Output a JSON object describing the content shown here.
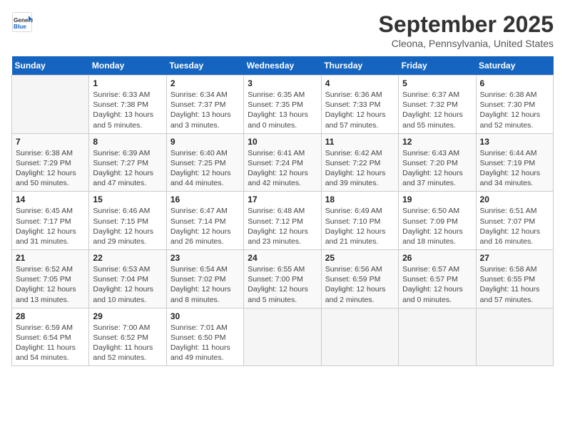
{
  "header": {
    "logo_line1": "General",
    "logo_line2": "Blue",
    "month": "September 2025",
    "location": "Cleona, Pennsylvania, United States"
  },
  "days_of_week": [
    "Sunday",
    "Monday",
    "Tuesday",
    "Wednesday",
    "Thursday",
    "Friday",
    "Saturday"
  ],
  "weeks": [
    [
      {
        "day": "",
        "text": ""
      },
      {
        "day": "1",
        "text": "Sunrise: 6:33 AM\nSunset: 7:38 PM\nDaylight: 13 hours\nand 5 minutes."
      },
      {
        "day": "2",
        "text": "Sunrise: 6:34 AM\nSunset: 7:37 PM\nDaylight: 13 hours\nand 3 minutes."
      },
      {
        "day": "3",
        "text": "Sunrise: 6:35 AM\nSunset: 7:35 PM\nDaylight: 13 hours\nand 0 minutes."
      },
      {
        "day": "4",
        "text": "Sunrise: 6:36 AM\nSunset: 7:33 PM\nDaylight: 12 hours\nand 57 minutes."
      },
      {
        "day": "5",
        "text": "Sunrise: 6:37 AM\nSunset: 7:32 PM\nDaylight: 12 hours\nand 55 minutes."
      },
      {
        "day": "6",
        "text": "Sunrise: 6:38 AM\nSunset: 7:30 PM\nDaylight: 12 hours\nand 52 minutes."
      }
    ],
    [
      {
        "day": "7",
        "text": "Sunrise: 6:38 AM\nSunset: 7:29 PM\nDaylight: 12 hours\nand 50 minutes."
      },
      {
        "day": "8",
        "text": "Sunrise: 6:39 AM\nSunset: 7:27 PM\nDaylight: 12 hours\nand 47 minutes."
      },
      {
        "day": "9",
        "text": "Sunrise: 6:40 AM\nSunset: 7:25 PM\nDaylight: 12 hours\nand 44 minutes."
      },
      {
        "day": "10",
        "text": "Sunrise: 6:41 AM\nSunset: 7:24 PM\nDaylight: 12 hours\nand 42 minutes."
      },
      {
        "day": "11",
        "text": "Sunrise: 6:42 AM\nSunset: 7:22 PM\nDaylight: 12 hours\nand 39 minutes."
      },
      {
        "day": "12",
        "text": "Sunrise: 6:43 AM\nSunset: 7:20 PM\nDaylight: 12 hours\nand 37 minutes."
      },
      {
        "day": "13",
        "text": "Sunrise: 6:44 AM\nSunset: 7:19 PM\nDaylight: 12 hours\nand 34 minutes."
      }
    ],
    [
      {
        "day": "14",
        "text": "Sunrise: 6:45 AM\nSunset: 7:17 PM\nDaylight: 12 hours\nand 31 minutes."
      },
      {
        "day": "15",
        "text": "Sunrise: 6:46 AM\nSunset: 7:15 PM\nDaylight: 12 hours\nand 29 minutes."
      },
      {
        "day": "16",
        "text": "Sunrise: 6:47 AM\nSunset: 7:14 PM\nDaylight: 12 hours\nand 26 minutes."
      },
      {
        "day": "17",
        "text": "Sunrise: 6:48 AM\nSunset: 7:12 PM\nDaylight: 12 hours\nand 23 minutes."
      },
      {
        "day": "18",
        "text": "Sunrise: 6:49 AM\nSunset: 7:10 PM\nDaylight: 12 hours\nand 21 minutes."
      },
      {
        "day": "19",
        "text": "Sunrise: 6:50 AM\nSunset: 7:09 PM\nDaylight: 12 hours\nand 18 minutes."
      },
      {
        "day": "20",
        "text": "Sunrise: 6:51 AM\nSunset: 7:07 PM\nDaylight: 12 hours\nand 16 minutes."
      }
    ],
    [
      {
        "day": "21",
        "text": "Sunrise: 6:52 AM\nSunset: 7:05 PM\nDaylight: 12 hours\nand 13 minutes."
      },
      {
        "day": "22",
        "text": "Sunrise: 6:53 AM\nSunset: 7:04 PM\nDaylight: 12 hours\nand 10 minutes."
      },
      {
        "day": "23",
        "text": "Sunrise: 6:54 AM\nSunset: 7:02 PM\nDaylight: 12 hours\nand 8 minutes."
      },
      {
        "day": "24",
        "text": "Sunrise: 6:55 AM\nSunset: 7:00 PM\nDaylight: 12 hours\nand 5 minutes."
      },
      {
        "day": "25",
        "text": "Sunrise: 6:56 AM\nSunset: 6:59 PM\nDaylight: 12 hours\nand 2 minutes."
      },
      {
        "day": "26",
        "text": "Sunrise: 6:57 AM\nSunset: 6:57 PM\nDaylight: 12 hours\nand 0 minutes."
      },
      {
        "day": "27",
        "text": "Sunrise: 6:58 AM\nSunset: 6:55 PM\nDaylight: 11 hours\nand 57 minutes."
      }
    ],
    [
      {
        "day": "28",
        "text": "Sunrise: 6:59 AM\nSunset: 6:54 PM\nDaylight: 11 hours\nand 54 minutes."
      },
      {
        "day": "29",
        "text": "Sunrise: 7:00 AM\nSunset: 6:52 PM\nDaylight: 11 hours\nand 52 minutes."
      },
      {
        "day": "30",
        "text": "Sunrise: 7:01 AM\nSunset: 6:50 PM\nDaylight: 11 hours\nand 49 minutes."
      },
      {
        "day": "",
        "text": ""
      },
      {
        "day": "",
        "text": ""
      },
      {
        "day": "",
        "text": ""
      },
      {
        "day": "",
        "text": ""
      }
    ]
  ]
}
